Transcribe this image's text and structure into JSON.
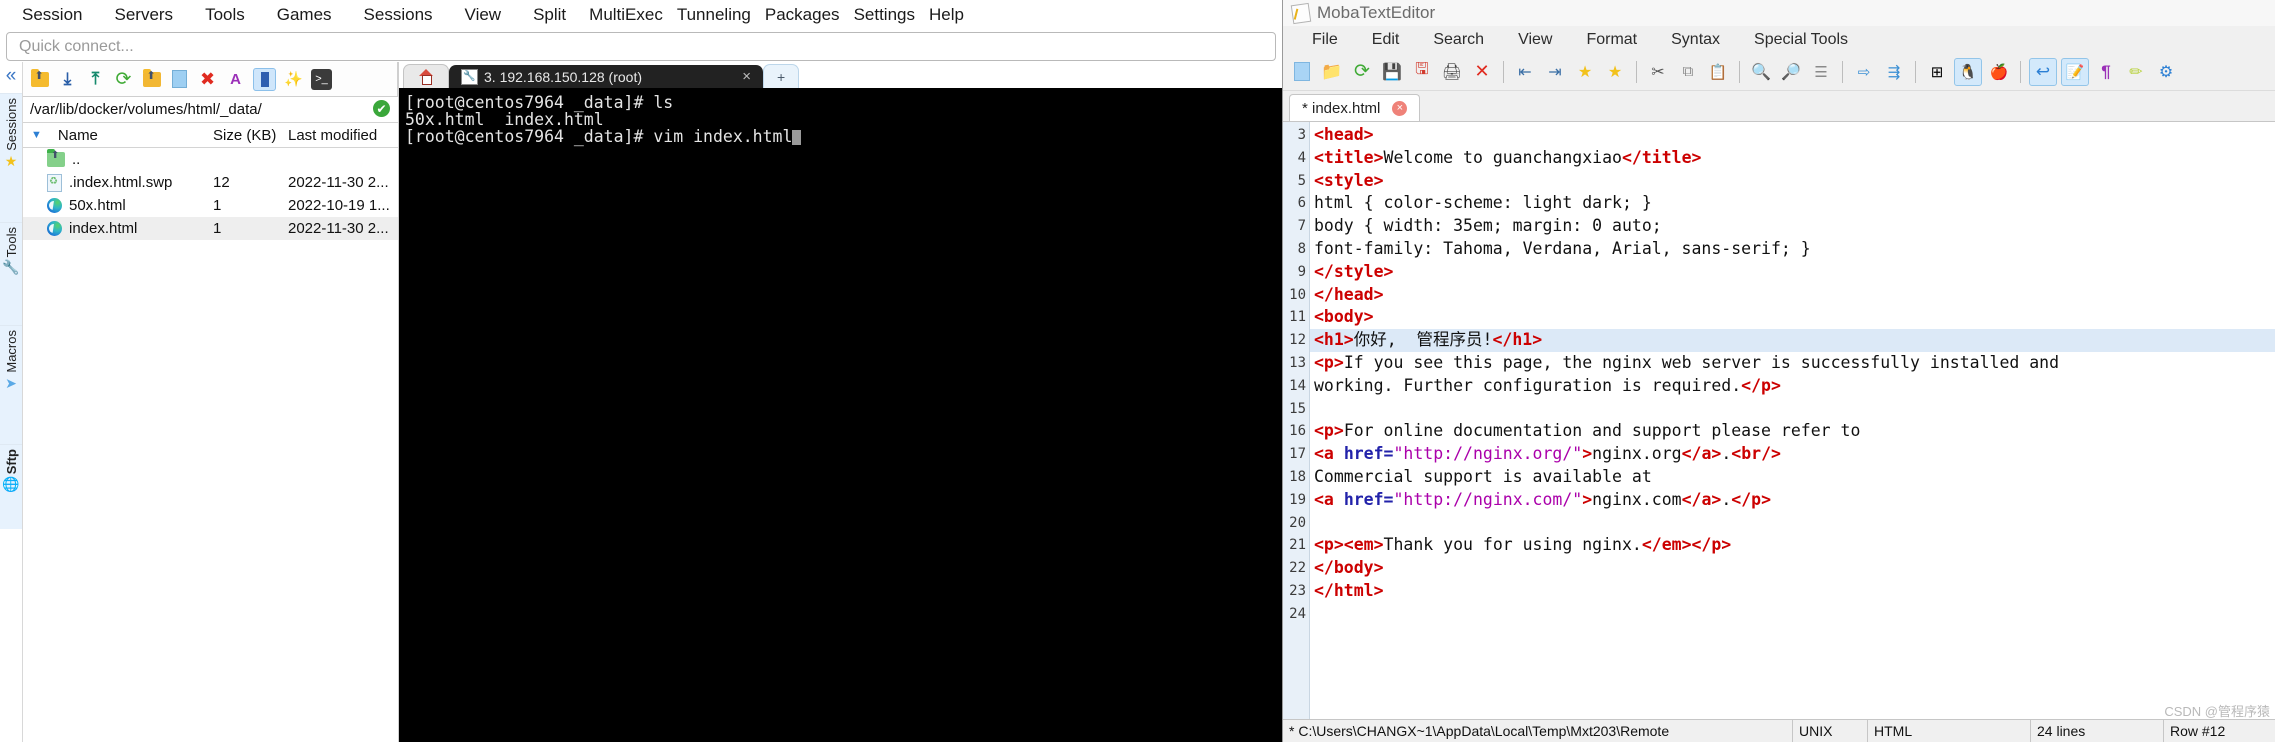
{
  "mobaxterm": {
    "menu": [
      "Session",
      "Servers",
      "Tools",
      "Games",
      "Sessions",
      "View",
      "Split",
      "MultiExec",
      "Tunneling",
      "Packages",
      "Settings",
      "Help"
    ],
    "quick_connect": {
      "placeholder": "Quick connect..."
    },
    "vertical_tabs": [
      {
        "label": "Sessions",
        "icon": "star-icon",
        "glyph": "★"
      },
      {
        "label": "Tools",
        "icon": "swiss-knife-icon",
        "glyph": "🔪"
      },
      {
        "label": "Macros",
        "icon": "paper-plane-icon",
        "glyph": "✈"
      },
      {
        "label": "Sftp",
        "icon": "globe-icon",
        "glyph": "🌐"
      }
    ],
    "sftp": {
      "toolbar": [
        {
          "name": "parent-folder-icon",
          "glyph": "⬆"
        },
        {
          "name": "download-icon",
          "glyph": "⤓"
        },
        {
          "name": "upload-icon",
          "glyph": "⤒"
        },
        {
          "name": "refresh-icon",
          "glyph": "⟳"
        },
        {
          "name": "new-folder-icon",
          "glyph": "📁"
        },
        {
          "name": "new-file-icon",
          "glyph": "📄"
        },
        {
          "name": "delete-icon",
          "glyph": "✖"
        },
        {
          "name": "text-mode-icon",
          "glyph": "A"
        },
        {
          "name": "follow-terminal-folder-icon",
          "glyph": "▮"
        },
        {
          "name": "magic-wand-icon",
          "glyph": "✨"
        },
        {
          "name": "open-terminal-icon",
          "glyph": "▸"
        }
      ],
      "path": "/var/lib/docker/volumes/html/_data/",
      "status_icon": "connected-check-icon",
      "columns": [
        "Name",
        "Size (KB)",
        "Last modified"
      ],
      "rows": [
        {
          "icon": "folder-up-icon",
          "name": "..",
          "size": "",
          "modified": "",
          "selected": false
        },
        {
          "icon": "swap-file-icon",
          "name": ".index.html.swp",
          "size": "12",
          "modified": "2022-11-30 2...",
          "selected": false
        },
        {
          "icon": "edge-html-icon",
          "name": "50x.html",
          "size": "1",
          "modified": "2022-10-19 1...",
          "selected": false
        },
        {
          "icon": "edge-html-icon",
          "name": "index.html",
          "size": "1",
          "modified": "2022-11-30 2...",
          "selected": true
        }
      ]
    },
    "terminal": {
      "tabs": [
        {
          "type": "home",
          "label": "",
          "icon": "home-icon"
        },
        {
          "type": "session",
          "label": "3. 192.168.150.128 (root)",
          "icon": "wrench-icon",
          "close": "×",
          "active": true
        },
        {
          "type": "new",
          "label": "+",
          "icon": "plus-icon"
        }
      ],
      "lines": [
        "[root@centos7964 _data]# ls",
        "50x.html  index.html",
        "[root@centos7964 _data]# vim index.html"
      ]
    }
  },
  "texteditor": {
    "title": "MobaTextEditor",
    "title_icon": "notepad-icon",
    "menu": [
      "File",
      "Edit",
      "Search",
      "View",
      "Format",
      "Syntax",
      "Special Tools"
    ],
    "toolbar": [
      {
        "name": "new-file-icon",
        "glyph": "📄",
        "selected": false
      },
      {
        "name": "open-folder-icon",
        "glyph": "📁",
        "selected": false
      },
      {
        "name": "reload-icon",
        "glyph": "⟳",
        "selected": false
      },
      {
        "name": "save-icon",
        "glyph": "💾",
        "selected": false
      },
      {
        "name": "save-as-icon",
        "glyph": "🖫",
        "selected": false
      },
      {
        "name": "print-icon",
        "glyph": "🖨",
        "selected": false
      },
      {
        "name": "close-file-icon",
        "glyph": "✕",
        "selected": false
      },
      {
        "sep": true
      },
      {
        "name": "decrease-indent-icon",
        "glyph": "⇤",
        "selected": false
      },
      {
        "name": "increase-indent-icon",
        "glyph": "⇥",
        "selected": false
      },
      {
        "name": "add-bookmark-icon",
        "glyph": "★",
        "selected": false
      },
      {
        "name": "next-bookmark-icon",
        "glyph": "★",
        "selected": false
      },
      {
        "sep": true
      },
      {
        "name": "cut-icon",
        "glyph": "✂",
        "selected": false
      },
      {
        "name": "copy-icon",
        "glyph": "⧉",
        "selected": false
      },
      {
        "name": "paste-icon",
        "glyph": "📋",
        "selected": false
      },
      {
        "sep": true
      },
      {
        "name": "find-icon",
        "glyph": "🔍",
        "selected": false
      },
      {
        "name": "replace-icon",
        "glyph": "🔎",
        "selected": false
      },
      {
        "name": "goto-line-icon",
        "glyph": "☰",
        "selected": false
      },
      {
        "sep": true
      },
      {
        "name": "send-to-remote-icon",
        "glyph": "⇨",
        "selected": false
      },
      {
        "name": "compare-icon",
        "glyph": "⇶",
        "selected": false
      },
      {
        "sep": true
      },
      {
        "name": "windows-format-icon",
        "glyph": "⊞",
        "selected": false
      },
      {
        "name": "unix-format-icon",
        "glyph": "🐧",
        "selected": true
      },
      {
        "name": "mac-format-icon",
        "glyph": "🍏",
        "selected": false
      },
      {
        "sep": true
      },
      {
        "name": "undo-icon",
        "glyph": "↩",
        "selected": true
      },
      {
        "name": "edit-mode-icon",
        "glyph": "📝",
        "selected": true
      },
      {
        "name": "show-paragraph-icon",
        "glyph": "¶",
        "selected": false
      },
      {
        "name": "highlight-icon",
        "glyph": "✏",
        "selected": false
      },
      {
        "name": "settings-icon",
        "glyph": "⚙",
        "selected": false
      }
    ],
    "doc_tab": {
      "label": "* index.html",
      "close": "×"
    },
    "first_line_number": 3,
    "lines": [
      {
        "n": 3,
        "highlight": false,
        "parts": [
          {
            "t": "tg",
            "s": "<head>"
          }
        ]
      },
      {
        "n": 4,
        "highlight": false,
        "parts": [
          {
            "t": "tg",
            "s": "<title>"
          },
          {
            "t": "pl",
            "s": "Welcome to guanchangxiao"
          },
          {
            "t": "tg",
            "s": "</title>"
          }
        ]
      },
      {
        "n": 5,
        "highlight": false,
        "parts": [
          {
            "t": "tg",
            "s": "<style>"
          }
        ]
      },
      {
        "n": 6,
        "highlight": false,
        "parts": [
          {
            "t": "pl",
            "s": "html { color-scheme: light dark; }"
          }
        ]
      },
      {
        "n": 7,
        "highlight": false,
        "parts": [
          {
            "t": "pl",
            "s": "body { width: 35em; margin: 0 auto;"
          }
        ]
      },
      {
        "n": 8,
        "highlight": false,
        "parts": [
          {
            "t": "pl",
            "s": "font-family: Tahoma, Verdana, Arial, sans-serif; }"
          }
        ]
      },
      {
        "n": 9,
        "highlight": false,
        "parts": [
          {
            "t": "tg",
            "s": "</style>"
          }
        ]
      },
      {
        "n": 10,
        "highlight": false,
        "parts": [
          {
            "t": "tg",
            "s": "</head>"
          }
        ]
      },
      {
        "n": 11,
        "highlight": false,
        "parts": [
          {
            "t": "tg",
            "s": "<body>"
          }
        ]
      },
      {
        "n": 12,
        "highlight": true,
        "parts": [
          {
            "t": "tg",
            "s": "<h1>"
          },
          {
            "t": "pl",
            "s": "你好,  管程序员!"
          },
          {
            "t": "tg",
            "s": "</h1>"
          }
        ]
      },
      {
        "n": 13,
        "highlight": false,
        "parts": [
          {
            "t": "tg",
            "s": "<p>"
          },
          {
            "t": "pl",
            "s": "If you see this page, the nginx web server is successfully installed and"
          }
        ]
      },
      {
        "n": 14,
        "highlight": false,
        "parts": [
          {
            "t": "pl",
            "s": "working. Further configuration is required."
          },
          {
            "t": "tg",
            "s": "</p>"
          }
        ]
      },
      {
        "n": 15,
        "highlight": false,
        "parts": [
          {
            "t": "pl",
            "s": ""
          }
        ]
      },
      {
        "n": 16,
        "highlight": false,
        "parts": [
          {
            "t": "tg",
            "s": "<p>"
          },
          {
            "t": "pl",
            "s": "For online documentation and support please refer to"
          }
        ]
      },
      {
        "n": 17,
        "highlight": false,
        "parts": [
          {
            "t": "tg",
            "s": "<a "
          },
          {
            "t": "at",
            "s": "href="
          },
          {
            "t": "st",
            "s": "\"http://nginx.org/\""
          },
          {
            "t": "tg",
            "s": ">"
          },
          {
            "t": "pl",
            "s": "nginx.org"
          },
          {
            "t": "tg",
            "s": "</a>"
          },
          {
            "t": "pl",
            "s": "."
          },
          {
            "t": "tg",
            "s": "<br/>"
          }
        ]
      },
      {
        "n": 18,
        "highlight": false,
        "parts": [
          {
            "t": "pl",
            "s": "Commercial support is available at"
          }
        ]
      },
      {
        "n": 19,
        "highlight": false,
        "parts": [
          {
            "t": "tg",
            "s": "<a "
          },
          {
            "t": "at",
            "s": "href="
          },
          {
            "t": "st",
            "s": "\"http://nginx.com/\""
          },
          {
            "t": "tg",
            "s": ">"
          },
          {
            "t": "pl",
            "s": "nginx.com"
          },
          {
            "t": "tg",
            "s": "</a>"
          },
          {
            "t": "pl",
            "s": "."
          },
          {
            "t": "tg",
            "s": "</p>"
          }
        ]
      },
      {
        "n": 20,
        "highlight": false,
        "parts": [
          {
            "t": "pl",
            "s": ""
          }
        ]
      },
      {
        "n": 21,
        "highlight": false,
        "parts": [
          {
            "t": "tg",
            "s": "<p><em>"
          },
          {
            "t": "pl",
            "s": "Thank you for using nginx."
          },
          {
            "t": "tg",
            "s": "</em></p>"
          }
        ]
      },
      {
        "n": 22,
        "highlight": false,
        "parts": [
          {
            "t": "tg",
            "s": "</body>"
          }
        ]
      },
      {
        "n": 23,
        "highlight": false,
        "parts": [
          {
            "t": "tg",
            "s": "</html>"
          }
        ]
      },
      {
        "n": 24,
        "highlight": false,
        "parts": [
          {
            "t": "pl",
            "s": ""
          }
        ]
      }
    ],
    "status": {
      "path": "* C:\\Users\\CHANGX~1\\AppData\\Local\\Temp\\Mxt203\\Remote",
      "format": "UNIX",
      "syntax": "HTML",
      "lines": "24 lines",
      "row": "Row #12"
    },
    "watermark": "CSDN @管程序猿"
  }
}
